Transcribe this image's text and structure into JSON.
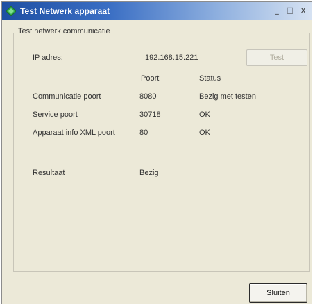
{
  "window": {
    "title": "Test Netwerk apparaat",
    "controls": {
      "minimize": "_",
      "maximize": "□",
      "close": "x"
    }
  },
  "group": {
    "legend": "Test netwerk communicatie",
    "ip_label": "IP adres:",
    "ip_value": "192.168.15.221",
    "test_button": "Test",
    "col_port": "Poort",
    "col_status": "Status",
    "rows": [
      {
        "label": "Communicatie poort",
        "port": "8080",
        "status": "Bezig met testen"
      },
      {
        "label": "Service poort",
        "port": "30718",
        "status": "OK"
      },
      {
        "label": "Apparaat info XML poort",
        "port": "80",
        "status": "OK"
      }
    ],
    "result_label": "Resultaat",
    "result_value": "Bezig"
  },
  "footer": {
    "close_button": "Sluiten"
  },
  "colors": {
    "titlebar_start": "#1e4fa3",
    "titlebar_end": "#d6e2f2",
    "window_bg": "#ece9d8",
    "icon_green": "#2fa84a"
  },
  "icons": {
    "app": "green-diamond-icon"
  }
}
